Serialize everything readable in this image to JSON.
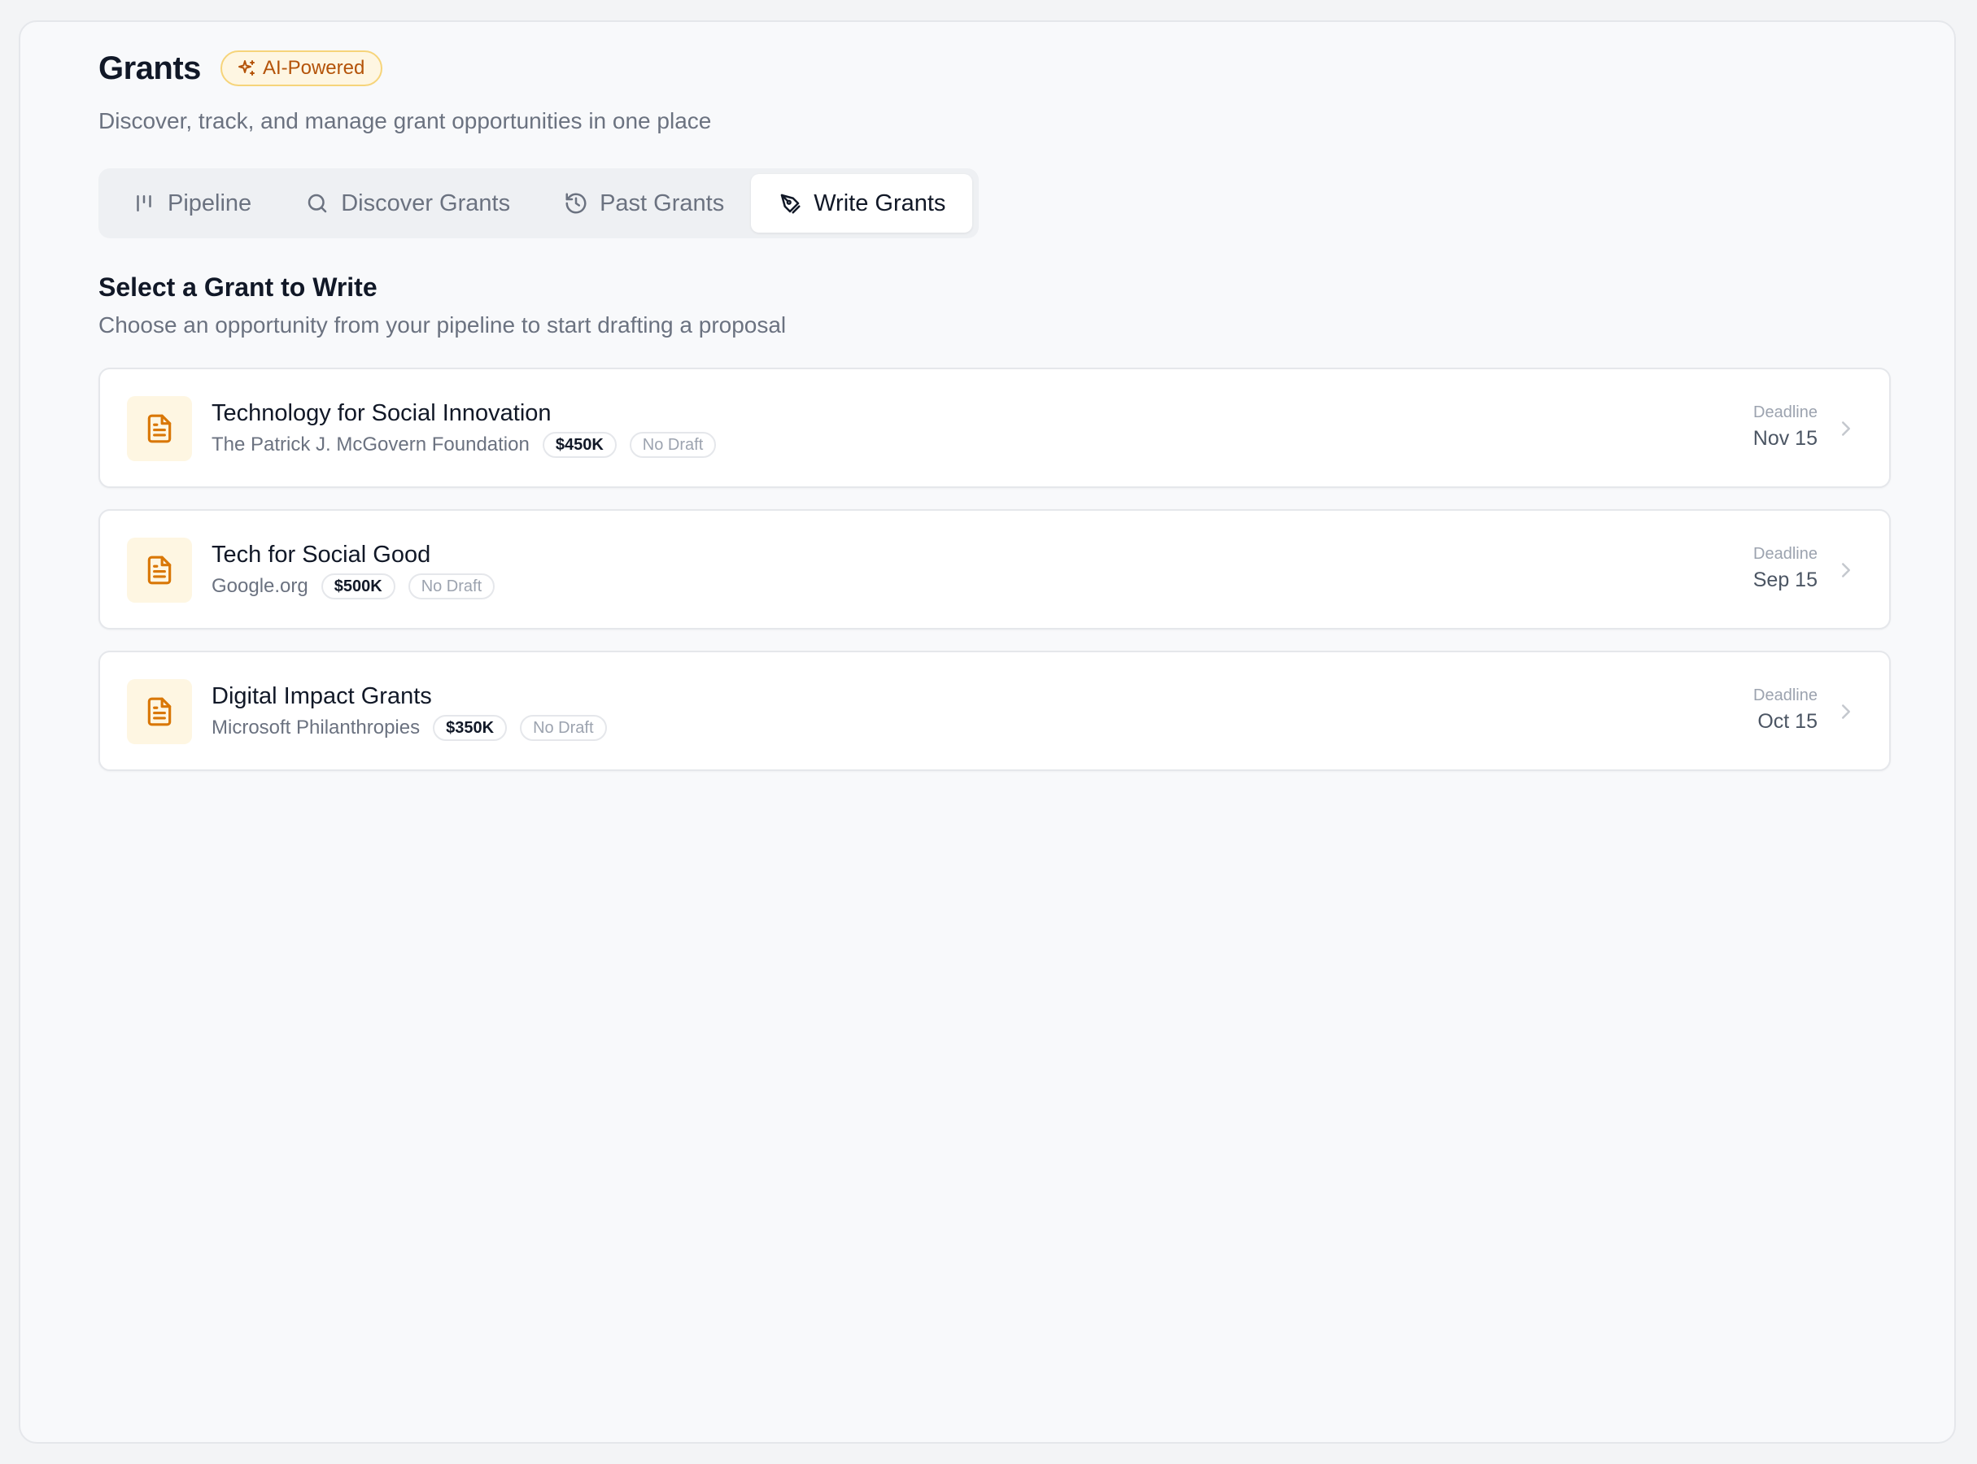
{
  "header": {
    "title": "Grants",
    "badge": "AI-Powered",
    "subtitle": "Discover, track, and manage grant opportunities in one place"
  },
  "tabs": [
    {
      "label": "Pipeline",
      "icon": "kanban-icon",
      "active": false
    },
    {
      "label": "Discover Grants",
      "icon": "search-icon",
      "active": false
    },
    {
      "label": "Past Grants",
      "icon": "history-icon",
      "active": false
    },
    {
      "label": "Write Grants",
      "icon": "pen-tool-icon",
      "active": true
    }
  ],
  "section": {
    "title": "Select a Grant to Write",
    "subtitle": "Choose an opportunity from your pipeline to start drafting a proposal"
  },
  "grants": [
    {
      "title": "Technology for Social Innovation",
      "funder": "The Patrick J. McGovern Foundation",
      "amount": "$450K",
      "status": "No Draft",
      "deadline_label": "Deadline",
      "deadline": "Nov 15"
    },
    {
      "title": "Tech for Social Good",
      "funder": "Google.org",
      "amount": "$500K",
      "status": "No Draft",
      "deadline_label": "Deadline",
      "deadline": "Sep 15"
    },
    {
      "title": "Digital Impact Grants",
      "funder": "Microsoft Philanthropies",
      "amount": "$350K",
      "status": "No Draft",
      "deadline_label": "Deadline",
      "deadline": "Oct 15"
    }
  ],
  "colors": {
    "accent": "#d97706",
    "badge_bg": "#fef6e2",
    "badge_border": "#f6d47a",
    "muted_text": "#6b7280"
  }
}
